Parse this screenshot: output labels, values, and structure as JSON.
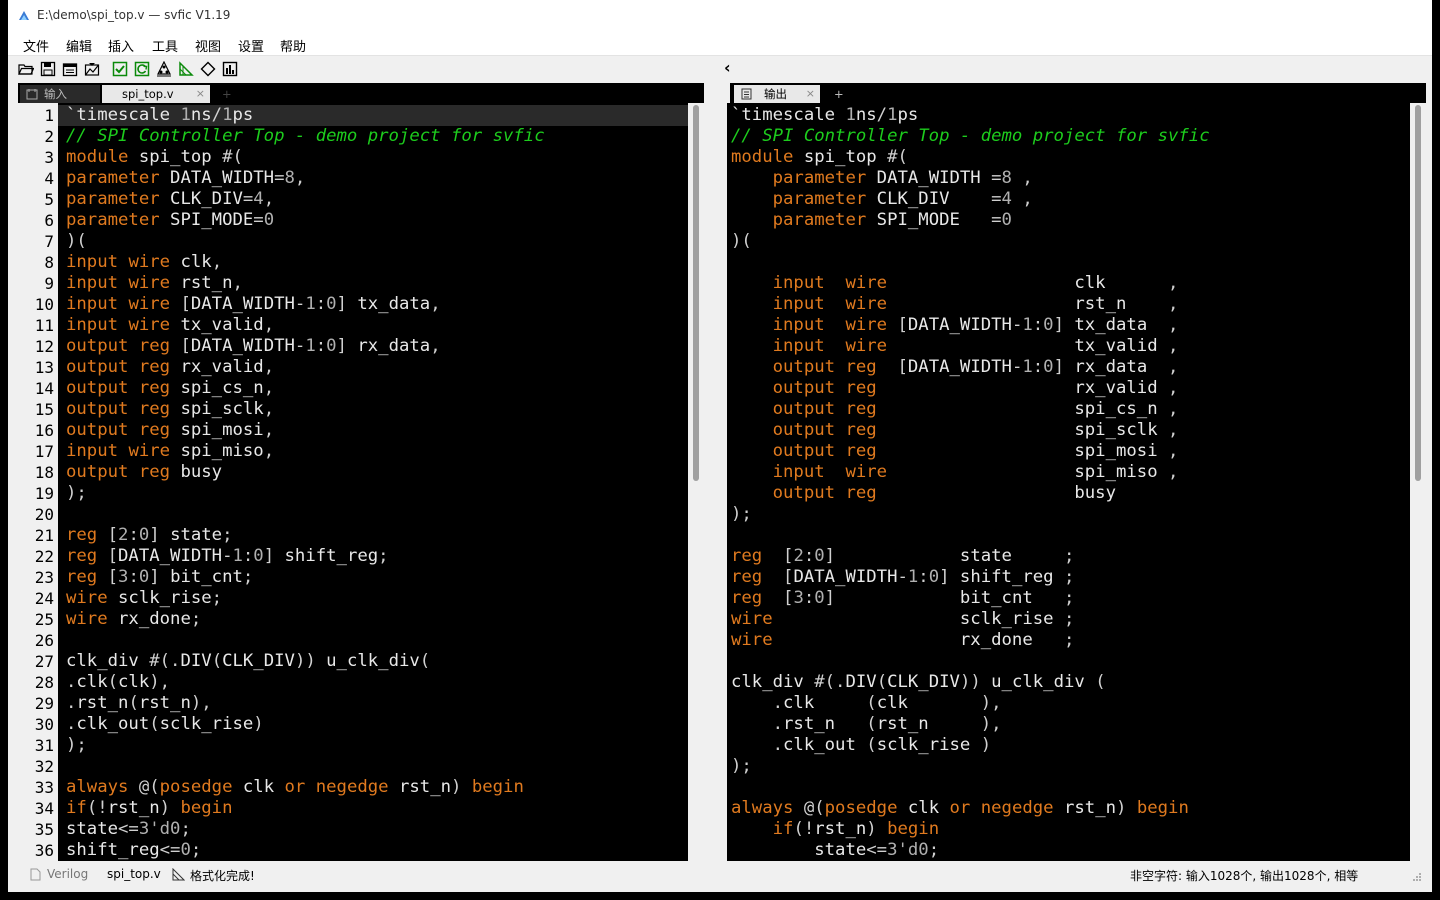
{
  "window": {
    "title": "E:\\demo\\spi_top.v — svfic V1.19"
  },
  "menu": [
    "文件",
    "编辑",
    "插入",
    "工具",
    "视图",
    "设置",
    "帮助"
  ],
  "toolbar": {
    "icons": [
      "open-folder-icon",
      "save-icon",
      "save-all-icon",
      "reload-icon",
      "check-icon",
      "refresh-icon",
      "tree-icon",
      "triangle-icon",
      "diamond-icon",
      "report-icon"
    ]
  },
  "left_tabs": {
    "input_label": "输入",
    "file_label": "spi_top.v",
    "close": "×",
    "add": "+"
  },
  "right_tabs": {
    "output_label": "输出",
    "close": "×",
    "add": "+"
  },
  "collapse_glyph": "‹",
  "left_editor": {
    "line_numbers": [
      "1",
      "2",
      "3",
      "4",
      "5",
      "6",
      "7",
      "8",
      "9",
      "10",
      "11",
      "12",
      "13",
      "14",
      "15",
      "16",
      "17",
      "18",
      "19",
      "20",
      "21",
      "22",
      "23",
      "24",
      "25",
      "26",
      "27",
      "28",
      "29",
      "30",
      "31",
      "32",
      "33",
      "34",
      "35",
      "36"
    ],
    "lines": [
      "`timescale 1ns/1ps",
      "// SPI Controller Top - demo project for svfic",
      "module spi_top #(",
      "parameter DATA_WIDTH=8,",
      "parameter CLK_DIV=4,",
      "parameter SPI_MODE=0",
      ")(",
      "input wire clk,",
      "input wire rst_n,",
      "input wire [DATA_WIDTH-1:0] tx_data,",
      "input wire tx_valid,",
      "output reg [DATA_WIDTH-1:0] rx_data,",
      "output reg rx_valid,",
      "output reg spi_cs_n,",
      "output reg spi_sclk,",
      "output reg spi_mosi,",
      "input wire spi_miso,",
      "output reg busy",
      ");",
      "",
      "reg [2:0] state;",
      "reg [DATA_WIDTH-1:0] shift_reg;",
      "reg [3:0] bit_cnt;",
      "wire sclk_rise;",
      "wire rx_done;",
      "",
      "clk_div #(.DIV(CLK_DIV)) u_clk_div(",
      ".clk(clk),",
      ".rst_n(rst_n),",
      ".clk_out(sclk_rise)",
      ");",
      "",
      "always @(posedge clk or negedge rst_n) begin",
      "if(!rst_n) begin",
      "state<=3'd0;",
      "shift_reg<=0;"
    ]
  },
  "right_editor": {
    "lines": [
      "`timescale 1ns/1ps",
      "// SPI Controller Top - demo project for svfic",
      "module spi_top #(",
      "    parameter DATA_WIDTH =8 ,",
      "    parameter CLK_DIV    =4 ,",
      "    parameter SPI_MODE   =0",
      ")(",
      "",
      "    input  wire                  clk      ,",
      "    input  wire                  rst_n    ,",
      "    input  wire [DATA_WIDTH-1:0] tx_data  ,",
      "    input  wire                  tx_valid ,",
      "    output reg  [DATA_WIDTH-1:0] rx_data  ,",
      "    output reg                   rx_valid ,",
      "    output reg                   spi_cs_n ,",
      "    output reg                   spi_sclk ,",
      "    output reg                   spi_mosi ,",
      "    input  wire                  spi_miso ,",
      "    output reg                   busy",
      ");",
      "",
      "reg  [2:0]            state     ;",
      "reg  [DATA_WIDTH-1:0] shift_reg ;",
      "reg  [3:0]            bit_cnt   ;",
      "wire                  sclk_rise ;",
      "wire                  rx_done   ;",
      "",
      "clk_div #(.DIV(CLK_DIV)) u_clk_div (",
      "    .clk     (clk       ),",
      "    .rst_n   (rst_n     ),",
      "    .clk_out (sclk_rise )",
      ");",
      "",
      "always @(posedge clk or negedge rst_n) begin",
      "    if(!rst_n) begin",
      "        state<=3'd0;"
    ]
  },
  "status": {
    "language": "Verilog",
    "file": "spi_top.v",
    "message": "格式化完成!",
    "stats": "非空字符: 输入1028个, 输出1028个, 相等"
  }
}
